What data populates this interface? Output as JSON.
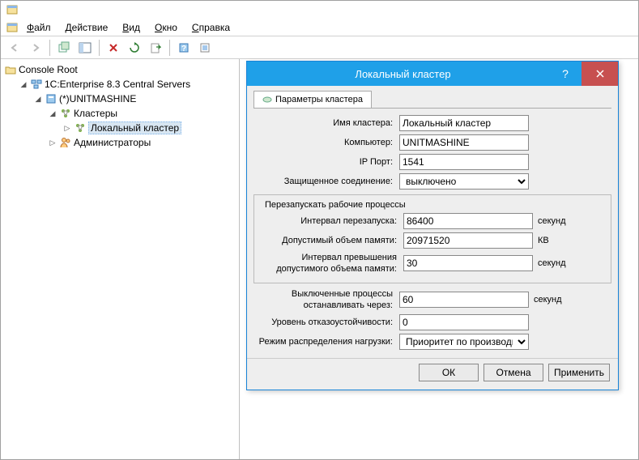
{
  "menu": {
    "file": {
      "u": "Ф",
      "r": "айл"
    },
    "action": {
      "u": "Д",
      "r": "ействие"
    },
    "view": {
      "u": "В",
      "r": "ид"
    },
    "window": {
      "u": "О",
      "r": "кно"
    },
    "help": {
      "u": "С",
      "r": "правка"
    }
  },
  "tree": {
    "root": "Console Root",
    "servers": "1C:Enterprise 8.3 Central Servers",
    "server_name": "(*)UNITMASHINE",
    "clusters": "Кластеры",
    "local_cluster": "Локальный кластер",
    "admins": "Администраторы"
  },
  "dialog": {
    "title": "Локальный кластер",
    "tab": "Параметры кластера",
    "group_restart": "Перезапускать рабочие процессы",
    "labels": {
      "cluster_name": "Имя кластера:",
      "computer": "Компьютер:",
      "ip_port": "IP Порт:",
      "secure_conn": "Защищенное соединение:",
      "restart_interval": "Интервал перезапуска:",
      "max_memory": "Допустимый объем памяти:",
      "excess_interval": "Интервал превышения допустимого объема памяти:",
      "stop_after": "Выключенные процессы останавливать через:",
      "fault_tolerance": "Уровень отказоустойчивости:",
      "load_balancing": "Режим распределения нагрузки:"
    },
    "values": {
      "cluster_name": "Локальный кластер",
      "computer": "UNITMASHINE",
      "ip_port": "1541",
      "secure_conn": "выключено",
      "restart_interval": "86400",
      "max_memory": "20971520",
      "excess_interval": "30",
      "stop_after": "60",
      "fault_tolerance": "0",
      "load_balancing": "Приоритет по производительн"
    },
    "units": {
      "seconds": "секунд",
      "kb": "КВ"
    },
    "buttons": {
      "ok": "ОК",
      "cancel": "Отмена",
      "apply": "Применить"
    }
  }
}
